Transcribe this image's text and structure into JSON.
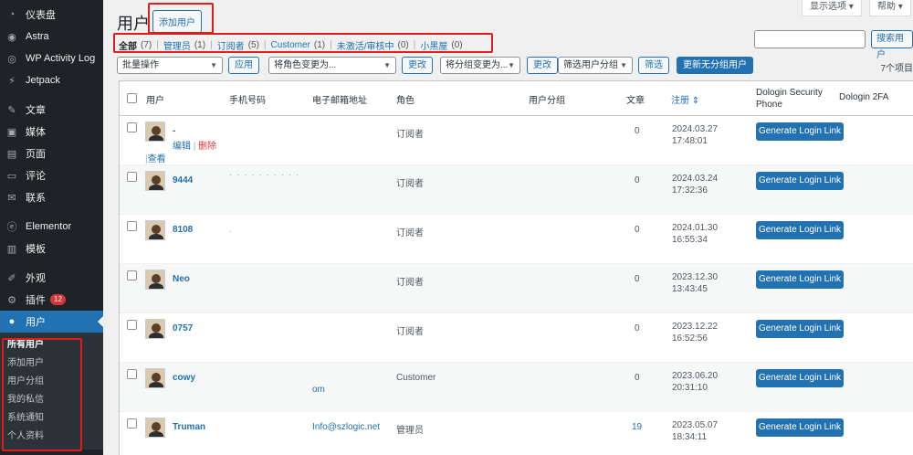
{
  "sidebar": {
    "items": [
      {
        "label": "仪表盘",
        "icon": "dashboard-icon"
      },
      {
        "label": "Astra",
        "icon": "astra-icon"
      },
      {
        "label": "WP Activity Log",
        "icon": "activity-log-icon"
      },
      {
        "label": "Jetpack",
        "icon": "jetpack-icon"
      },
      {
        "label": "文章",
        "icon": "pin-icon"
      },
      {
        "label": "媒体",
        "icon": "media-icon"
      },
      {
        "label": "页面",
        "icon": "page-icon"
      },
      {
        "label": "评论",
        "icon": "comment-icon"
      },
      {
        "label": "联系",
        "icon": "mail-icon"
      },
      {
        "label": "Elementor",
        "icon": "elementor-icon"
      },
      {
        "label": "模板",
        "icon": "template-icon"
      },
      {
        "label": "外观",
        "icon": "brush-icon"
      },
      {
        "label": "插件",
        "icon": "plugin-icon",
        "badge": "12"
      },
      {
        "label": "用户",
        "icon": "user-icon"
      }
    ],
    "submenu": [
      "所有用户",
      "添加用户",
      "用户分组",
      "我的私信",
      "系统通知",
      "个人资料"
    ]
  },
  "header": {
    "title": "用户",
    "add_user": "添加用户",
    "screen_options": "显示选项 ▾",
    "help": "帮助 ▾"
  },
  "filters": [
    {
      "label": "全部",
      "count": "(7)"
    },
    {
      "label": "管理员",
      "count": "(1)"
    },
    {
      "label": "订阅者",
      "count": "(5)"
    },
    {
      "label": "Customer",
      "count": "(1)"
    },
    {
      "label": "未激活/审核中",
      "count": "(0)"
    },
    {
      "label": "小黑屋",
      "count": "(0)"
    }
  ],
  "search": {
    "button": "搜索用户",
    "value": ""
  },
  "toolbar": {
    "bulk": "批量操作",
    "apply": "应用",
    "role_change": "将角色变更为...",
    "change": "更改",
    "group_change": "将分组变更为...",
    "change2": "更改",
    "filter_group": "筛选用户分组",
    "filter": "筛选",
    "update_ungrouped": "更新无分组用户",
    "count": "7个项目"
  },
  "columns": {
    "user": "用户",
    "phone": "手机号码",
    "email": "电子邮箱地址",
    "role": "角色",
    "group": "用户分组",
    "posts": "文章",
    "registered": "注册 ⇕",
    "security_phone_1": "Dologin Security",
    "security_phone_2": "Phone",
    "twofa": "Dologin 2FA"
  },
  "row_actions": {
    "edit": "编辑",
    "delete": "删除",
    "view": "查看",
    "sep": "|"
  },
  "gll_label": "Generate Login Link",
  "rows": [
    {
      "name": "-",
      "phone": "",
      "email": "",
      "role": "订阅者",
      "posts": "0",
      "date": "2024.03.27",
      "time": "17:48:01"
    },
    {
      "name": "9444",
      "phone": "· · · · · · · · · ·",
      "email": "",
      "role": "订阅者",
      "posts": "0",
      "date": "2024.03.24",
      "time": "17:32:36"
    },
    {
      "name": "8108",
      "phone": ".",
      "email": "",
      "role": "订阅者",
      "posts": "0",
      "date": "2024.01.30",
      "time": "16:55:34"
    },
    {
      "name": "Neo",
      "phone": "",
      "email": "",
      "role": "订阅者",
      "posts": "0",
      "date": "2023.12.30",
      "time": "13:43:45"
    },
    {
      "name": "0757",
      "phone": "",
      "email": "",
      "role": "订阅者",
      "posts": "0",
      "date": "2023.12.22",
      "time": "16:52:56"
    },
    {
      "name": "cowy",
      "phone": "",
      "email": "om",
      "role": "Customer",
      "posts": "0",
      "date": "2023.06.20",
      "time": "20:31:10"
    },
    {
      "name": "Truman",
      "phone": "",
      "email": "Info@szlogic.net",
      "role": "管理员",
      "posts": "19",
      "date": "2023.05.07",
      "time": "18:34:11"
    }
  ]
}
